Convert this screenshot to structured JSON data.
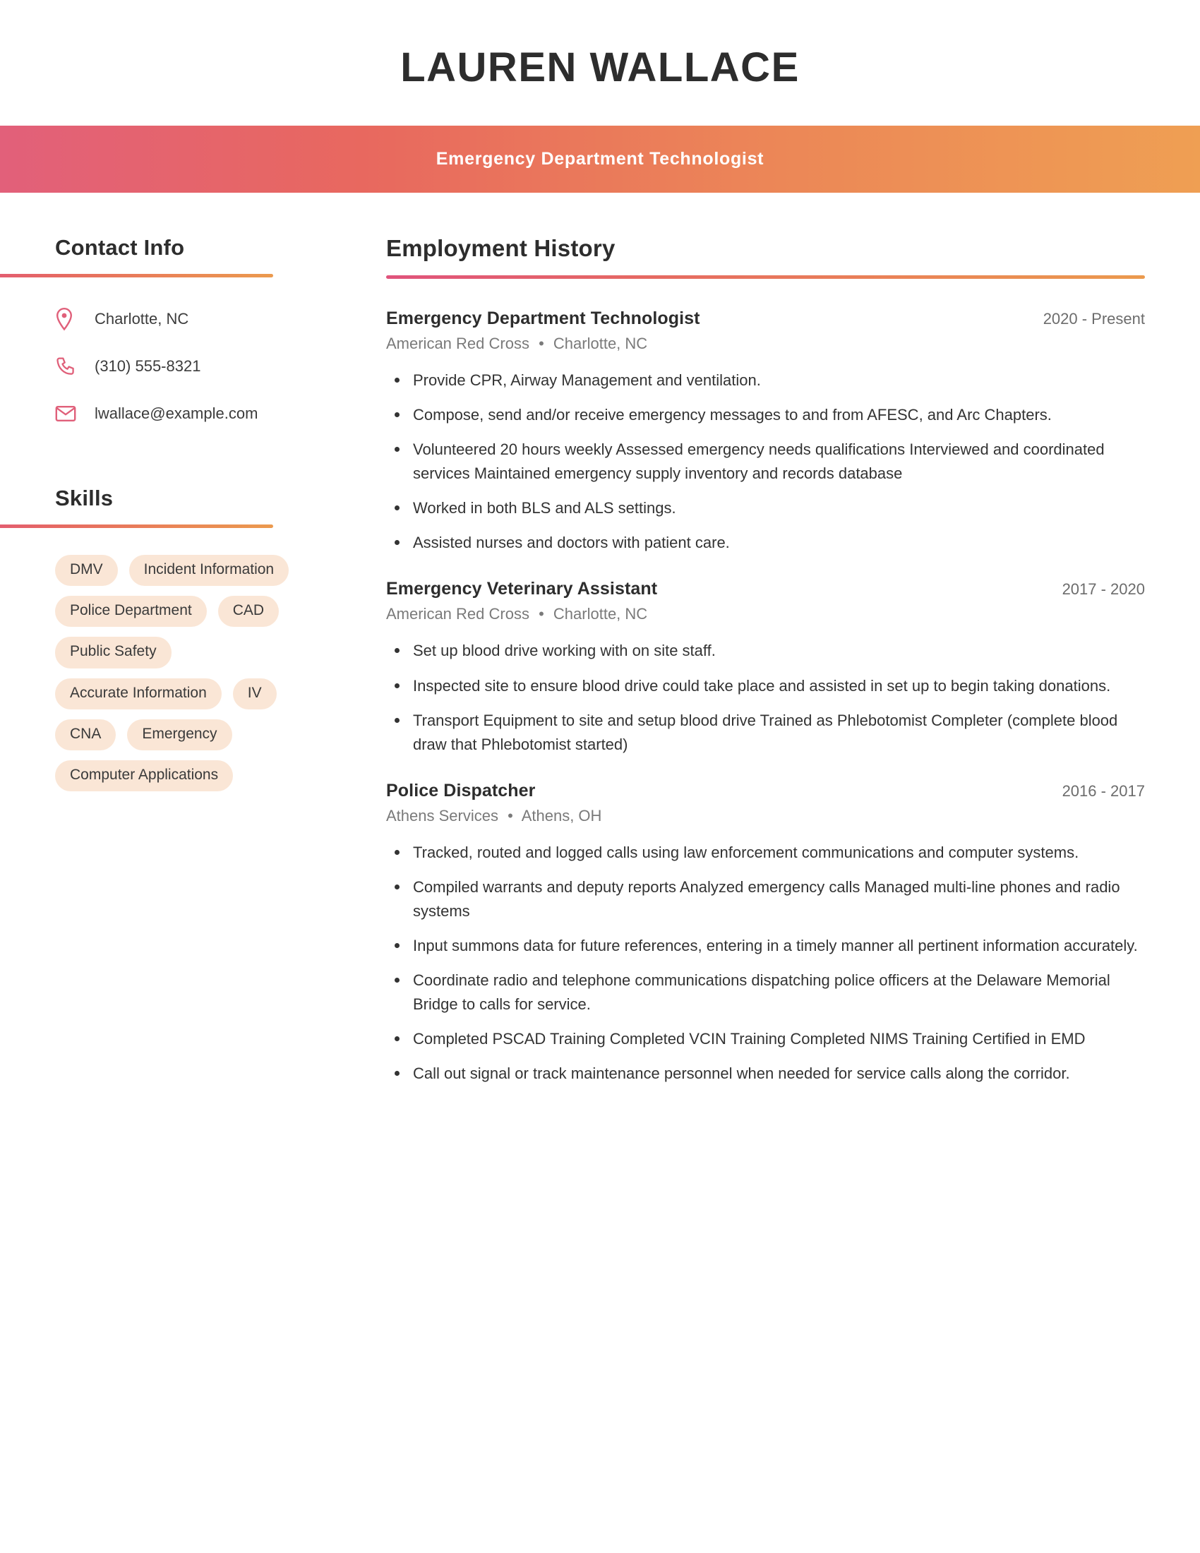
{
  "header": {
    "name": "LAUREN WALLACE",
    "title": "Emergency Department Technologist"
  },
  "colors": {
    "gradient_start": "#e0537c",
    "gradient_end": "#eb9a4e",
    "icon_accent": "#e0607a",
    "chip_background": "#fae6d6",
    "heading_text": "#2d2d2d",
    "body_text": "#333333",
    "muted_text": "#7a7a7a"
  },
  "sidebar": {
    "contact": {
      "heading": "Contact Info",
      "items": [
        {
          "icon": "location-pin-icon",
          "value": "Charlotte, NC"
        },
        {
          "icon": "phone-icon",
          "value": "(310) 555-8321"
        },
        {
          "icon": "envelope-icon",
          "value": "lwallace@example.com"
        }
      ]
    },
    "skills": {
      "heading": "Skills",
      "items": [
        "DMV",
        "Incident Information",
        "Police Department",
        "CAD",
        "Public Safety",
        "Accurate Information",
        "IV",
        "CNA",
        "Emergency",
        "Computer Applications"
      ]
    }
  },
  "main": {
    "employment": {
      "heading": "Employment History",
      "jobs": [
        {
          "title": "Emergency Department Technologist",
          "dates": "2020 - Present",
          "company": "American Red Cross",
          "location": "Charlotte, NC",
          "bullets": [
            "Provide CPR, Airway Management and ventilation.",
            "Compose, send and/or receive emergency messages to and from AFESC, and Arc Chapters.",
            "Volunteered 20 hours weekly Assessed emergency needs qualifications Interviewed and coordinated services Maintained emergency supply inventory and records database",
            "Worked in both BLS and ALS settings.",
            "Assisted nurses and doctors with patient care."
          ]
        },
        {
          "title": "Emergency Veterinary Assistant",
          "dates": "2017 - 2020",
          "company": "American Red Cross",
          "location": "Charlotte, NC",
          "bullets": [
            "Set up blood drive working with on site staff.",
            "Inspected site to ensure blood drive could take place and assisted in set up to begin taking donations.",
            "Transport Equipment to site and setup blood drive Trained as Phlebotomist Completer (complete blood draw that Phlebotomist started)"
          ]
        },
        {
          "title": "Police Dispatcher",
          "dates": "2016 - 2017",
          "company": "Athens Services",
          "location": "Athens, OH",
          "bullets": [
            "Tracked, routed and logged calls using law enforcement communications and computer systems.",
            "Compiled warrants and deputy reports Analyzed emergency calls Managed multi-line phones and radio systems",
            "Input summons data for future references, entering in a timely manner all pertinent information accurately.",
            "Coordinate radio and telephone communications dispatching police officers at the Delaware Memorial Bridge to calls for service.",
            "Completed PSCAD Training Completed VCIN Training Completed NIMS Training Certified in EMD",
            "Call out signal or track maintenance personnel when needed for service calls along the corridor."
          ]
        }
      ],
      "separator": "•"
    }
  }
}
